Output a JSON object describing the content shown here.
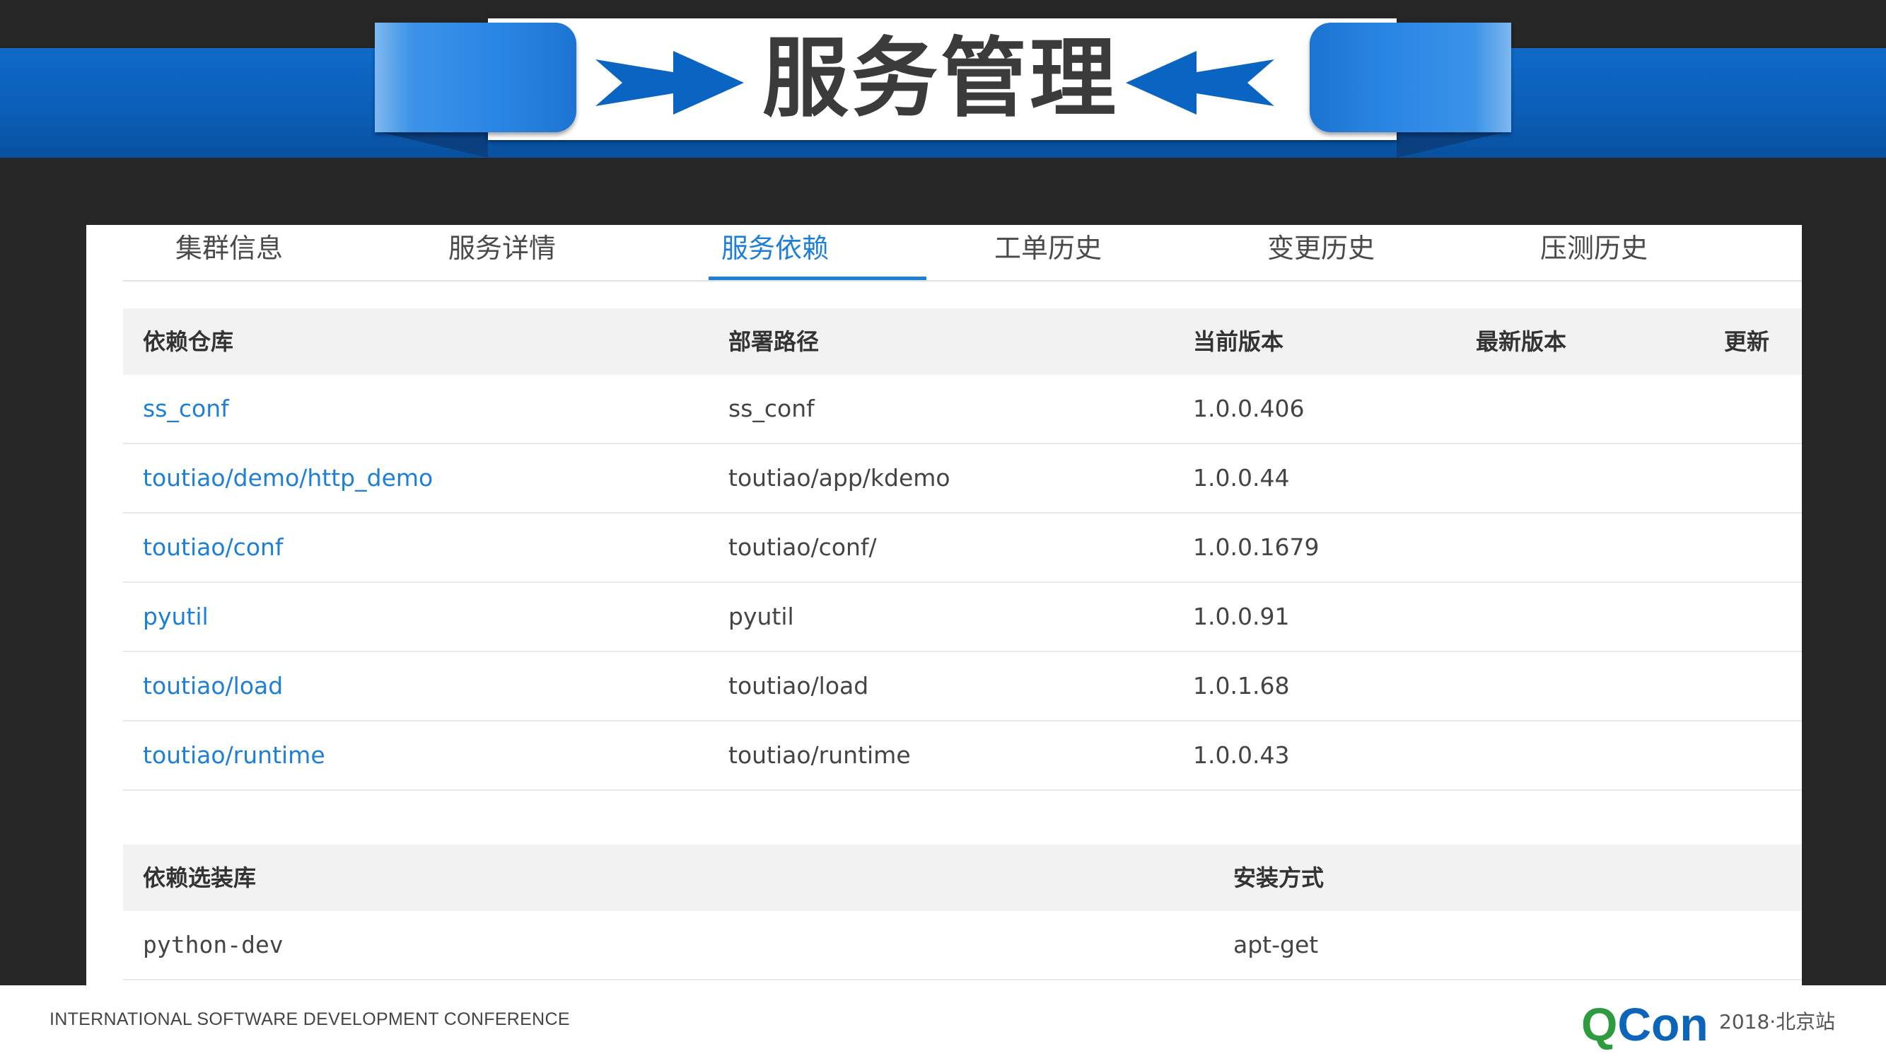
{
  "header": {
    "title": "服务管理"
  },
  "tabs": [
    {
      "label": "集群信息",
      "active": false
    },
    {
      "label": "服务详情",
      "active": false
    },
    {
      "label": "服务依赖",
      "active": true
    },
    {
      "label": "工单历史",
      "active": false
    },
    {
      "label": "变更历史",
      "active": false
    },
    {
      "label": "压测历史",
      "active": false
    }
  ],
  "dependencies": {
    "columns": [
      "依赖仓库",
      "部署路径",
      "当前版本",
      "最新版本",
      "更新"
    ],
    "rows": [
      {
        "repo": "ss_conf",
        "path": "ss_conf",
        "current": "1.0.0.406",
        "latest": "",
        "update": ""
      },
      {
        "repo": "toutiao/demo/http_demo",
        "path": "toutiao/app/kdemo",
        "current": "1.0.0.44",
        "latest": "",
        "update": ""
      },
      {
        "repo": "toutiao/conf",
        "path": "toutiao/conf/",
        "current": "1.0.0.1679",
        "latest": "",
        "update": ""
      },
      {
        "repo": "pyutil",
        "path": "pyutil",
        "current": "1.0.0.91",
        "latest": "",
        "update": ""
      },
      {
        "repo": "toutiao/load",
        "path": "toutiao/load",
        "current": "1.0.1.68",
        "latest": "",
        "update": ""
      },
      {
        "repo": "toutiao/runtime",
        "path": "toutiao/runtime",
        "current": "1.0.0.43",
        "latest": "",
        "update": ""
      }
    ]
  },
  "optional_packages": {
    "columns": [
      "依赖选装库",
      "安装方式"
    ],
    "rows": [
      {
        "name": "python-dev",
        "method": "apt-get"
      }
    ]
  },
  "footer": {
    "conference": "INTERNATIONAL SOFTWARE DEVELOPMENT CONFERENCE",
    "logo_q": "Q",
    "logo_con": "Con",
    "edition": "2018·北京站"
  },
  "colors": {
    "accent": "#1e7fd8",
    "banner_blue": "#0b5fb8",
    "logo_green": "#2e9b3f"
  }
}
